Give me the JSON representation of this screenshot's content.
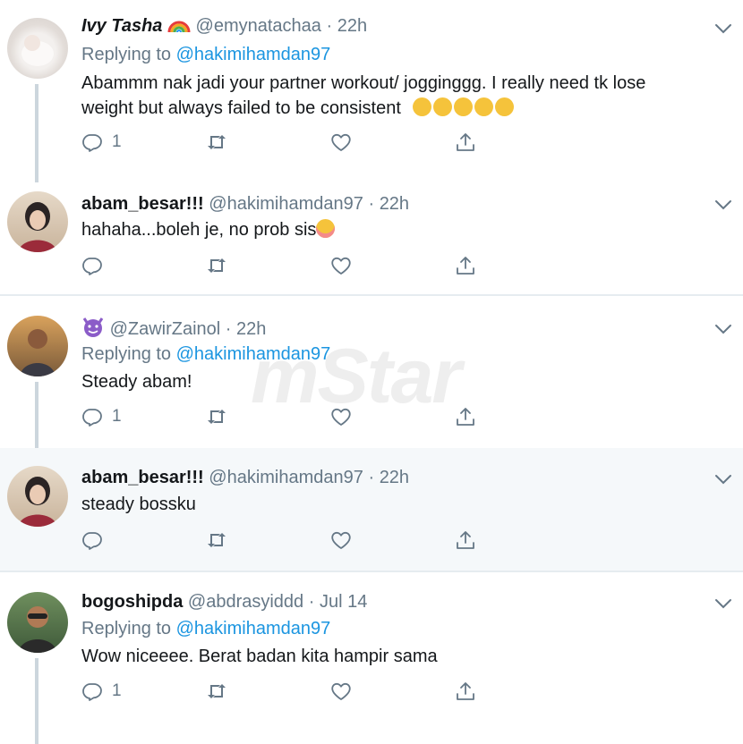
{
  "watermark": "mStar",
  "tweets": [
    {
      "name": "Ivy Tasha",
      "name_suffix_icon": "rainbow-emoji",
      "handle": "@emynatachaa",
      "time": "22h",
      "replying_label": "Replying to",
      "replying_to": "@hakimihamdan97",
      "text_line1": "Abammm nak jadi your partner workout/ jogginggg. I really need tk lose",
      "text_line2": "weight but always failed to be consistent",
      "text_emojis": [
        "disappointed-face",
        "disappointed-face",
        "disappointed-face",
        "disappointed-face",
        "disappointed-face"
      ],
      "reply_count": "1"
    },
    {
      "name": "abam_besar!!!",
      "handle": "@hakimihamdan97",
      "time": "22h",
      "text": "hahaha...boleh je, no prob sis",
      "text_emoji": "smiling-face-with-blush",
      "reply_count": ""
    },
    {
      "name_icon": "smiling-devil-emoji",
      "handle": "@ZawirZainol",
      "time": "22h",
      "replying_label": "Replying to",
      "replying_to": "@hakimihamdan97",
      "text": "Steady abam!",
      "reply_count": "1"
    },
    {
      "name": "abam_besar!!!",
      "handle": "@hakimihamdan97",
      "time": "22h",
      "text": "steady bossku",
      "reply_count": ""
    },
    {
      "name": "bogoshipda",
      "handle": "@abdrasyiddd",
      "time": "Jul 14",
      "replying_label": "Replying to",
      "replying_to": "@hakimihamdan97",
      "text": "Wow niceeee. Berat badan kita hampir sama",
      "reply_count": "1"
    }
  ],
  "colors": {
    "link": "#1b95e0",
    "secondary": "#657786",
    "highlight_bg": "#f5f8fa",
    "thread_line": "#ccd6dd"
  }
}
